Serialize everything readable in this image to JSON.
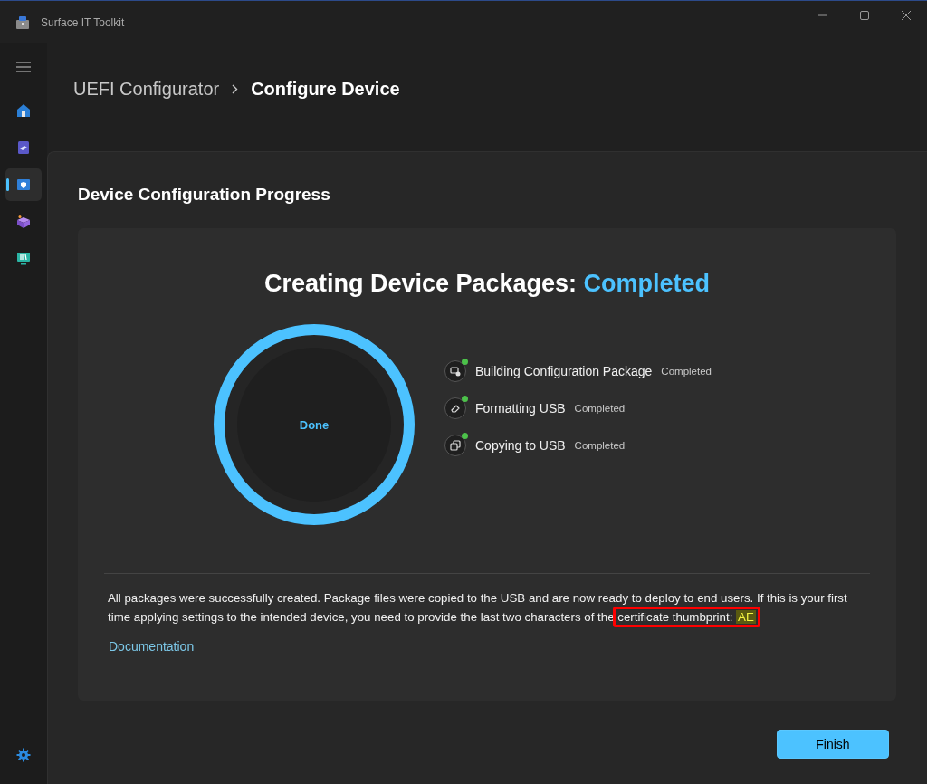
{
  "window": {
    "title": "Surface IT Toolkit"
  },
  "sidebar": {
    "items": [
      {
        "kind": "home",
        "selected": false
      },
      {
        "kind": "drive",
        "selected": false
      },
      {
        "kind": "shield",
        "selected": true
      },
      {
        "kind": "box",
        "selected": false
      },
      {
        "kind": "monitor",
        "selected": false
      }
    ]
  },
  "breadcrumb": [
    "UEFI Configurator",
    "Configure Device"
  ],
  "section_title": "Device Configuration Progress",
  "status": {
    "heading": "Creating Device Packages:",
    "state": "Completed"
  },
  "progress": {
    "level": 1.0,
    "label": "Done"
  },
  "steps": [
    {
      "kind": "package",
      "name": "Building Configuration Package",
      "status": "Completed",
      "completed": true
    },
    {
      "kind": "eraser",
      "name": "Formatting USB",
      "status": "Completed",
      "completed": true
    },
    {
      "kind": "copy",
      "name": "Copying to USB",
      "status": "Completed",
      "completed": true
    }
  ],
  "message": "All packages were successfully created. Package files were copied to the USB and are now ready to deploy to end users. If this is your first time applying settings to the intended device, you need to provide the last two characters of the",
  "callout": {
    "label": "certificate thumbprint:",
    "value": "AE"
  },
  "link": "Documentation",
  "buttons": [
    {
      "label": "Finish"
    }
  ]
}
